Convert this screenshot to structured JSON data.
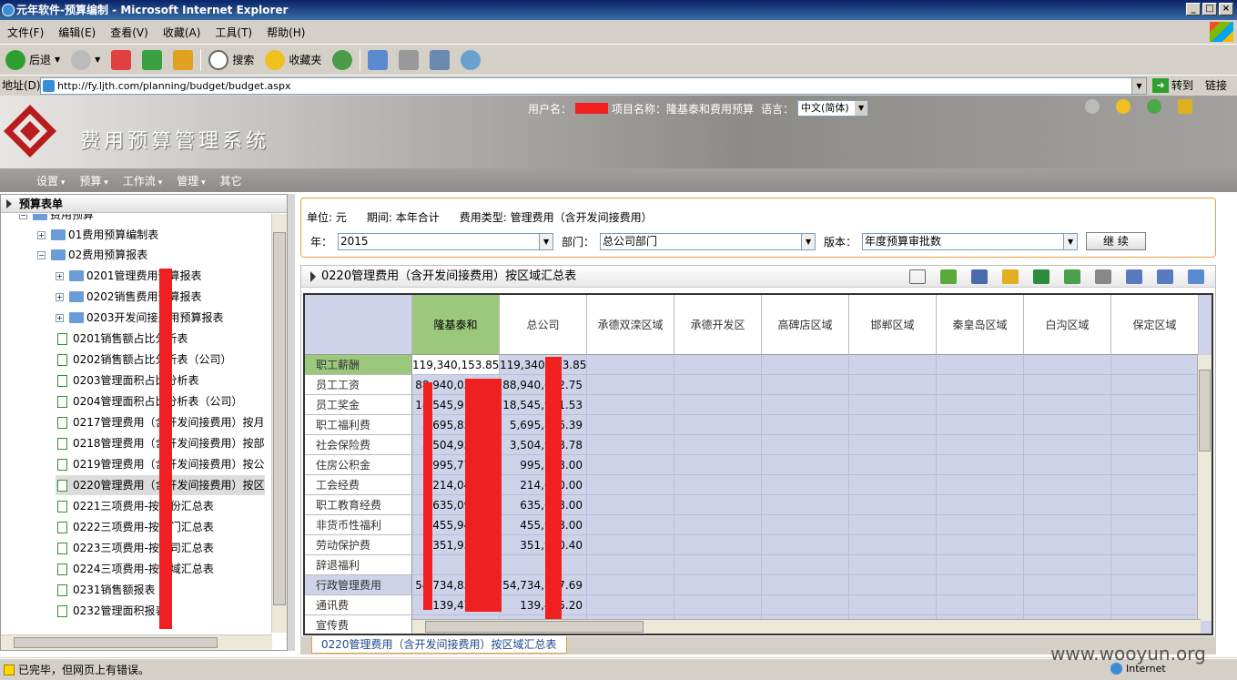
{
  "window": {
    "title": "元年软件-预算编制 - Microsoft Internet Explorer"
  },
  "menubar": [
    "文件(F)",
    "编辑(E)",
    "查看(V)",
    "收藏(A)",
    "工具(T)",
    "帮助(H)"
  ],
  "toolbar": {
    "back": "后退",
    "search": "搜索",
    "favorites": "收藏夹"
  },
  "address": {
    "label": "地址(D)",
    "url": "http://fy.ljth.com/planning/budget/budget.aspx",
    "go": "转到",
    "links": "链接"
  },
  "header": {
    "system_name": "费用预算管理系统",
    "user_label": "用户名：",
    "project_label": "项目名称：隆基泰和费用预算",
    "lang_label": "语言：",
    "lang_value": "中文(简体)"
  },
  "nav": [
    "设置",
    "预算",
    "工作流",
    "管理",
    "其它"
  ],
  "left": {
    "title": "预算表单",
    "items": [
      {
        "label": "费用预算",
        "kind": "folder"
      },
      {
        "label": "01费用预算编制表",
        "kind": "folder"
      },
      {
        "label": "02费用预算报表",
        "kind": "folder"
      },
      {
        "label": "0201管理费用预算报表",
        "kind": "folder"
      },
      {
        "label": "0202销售费用预算报表",
        "kind": "folder"
      },
      {
        "label": "0203开发间接费用预算报表",
        "kind": "folder"
      },
      {
        "label": "0201销售额占比分析表",
        "kind": "doc"
      },
      {
        "label": "0202销售额占比分析表（公司）",
        "kind": "doc"
      },
      {
        "label": "0203管理面积占比分析表",
        "kind": "doc"
      },
      {
        "label": "0204管理面积占比分析表（公司）",
        "kind": "doc"
      },
      {
        "label": "0217管理费用（含开发间接费用）按月",
        "kind": "doc"
      },
      {
        "label": "0218管理费用（含开发间接费用）按部",
        "kind": "doc"
      },
      {
        "label": "0219管理费用（含开发间接费用）按公",
        "kind": "doc"
      },
      {
        "label": "0220管理费用（含开发间接费用）按区",
        "kind": "doc"
      },
      {
        "label": "0221三项费用-按月份汇总表",
        "kind": "doc"
      },
      {
        "label": "0222三项费用-按部门汇总表",
        "kind": "doc"
      },
      {
        "label": "0223三项费用-按公司汇总表",
        "kind": "doc"
      },
      {
        "label": "0224三项费用-按区域汇总表",
        "kind": "doc"
      },
      {
        "label": "0231销售额报表",
        "kind": "doc"
      },
      {
        "label": "0232管理面积报表",
        "kind": "doc"
      }
    ]
  },
  "filter": {
    "unit": "单位: 元",
    "period": "期间: 本年合计",
    "fee_type": "费用类型: 管理费用（含开发间接费用）",
    "year_label": "年：",
    "year_value": "2015",
    "dept_label": "部门：",
    "dept_value": "总公司部门",
    "version_label": "版本：",
    "version_value": "年度预算审批数",
    "continue": "继 续"
  },
  "report": {
    "title": "0220管理费用（含开发间接费用）按区域汇总表",
    "columns": [
      "隆基泰和",
      "总公司",
      "承德双滦区域",
      "承德开发区",
      "高碑店区域",
      "邯郸区域",
      "秦皇岛区域",
      "白沟区域",
      "保定区域"
    ],
    "rows": [
      {
        "label": "职工薪酬",
        "v1": "119,340,153.85",
        "v2": "119,340,153.85"
      },
      {
        "label": "员工工资",
        "v1": "88,940,052.75",
        "v2": "88,940,052.75"
      },
      {
        "label": "员工奖金",
        "v1": "18,545,911.53",
        "v2": "18,545,911.53"
      },
      {
        "label": "职工福利费",
        "v1": "5,695,856.39",
        "v2": "5,695,856.39"
      },
      {
        "label": "社会保险费",
        "v1": "3,504,938.78",
        "v2": "3,504,938.78"
      },
      {
        "label": "住房公积金",
        "v1": "995,778.00",
        "v2": "995,778.00"
      },
      {
        "label": "工会经费",
        "v1": "214,040.00",
        "v2": "214,040.00"
      },
      {
        "label": "职工教育经费",
        "v1": "635,098.00",
        "v2": "635,098.00"
      },
      {
        "label": "非货币性福利",
        "v1": "455,948.00",
        "v2": "455,948.00"
      },
      {
        "label": "劳动保护费",
        "v1": "351,930.40",
        "v2": "351,930.40"
      },
      {
        "label": "辞退福利",
        "v1": "",
        "v2": ""
      },
      {
        "label": "行政管理费用",
        "v1": "54,734,837.69",
        "v2": "54,734,837.69"
      },
      {
        "label": "通讯费",
        "v1": "139,475.20",
        "v2": "139,475.20"
      },
      {
        "label": "宣传费",
        "v1": "",
        "v2": ""
      }
    ],
    "tab": "0220管理费用（含开发间接费用）按区域汇总表"
  },
  "status": {
    "text": "已完毕，但网页上有错误。",
    "zone": "Internet"
  },
  "watermark": "www.wooyun.org"
}
